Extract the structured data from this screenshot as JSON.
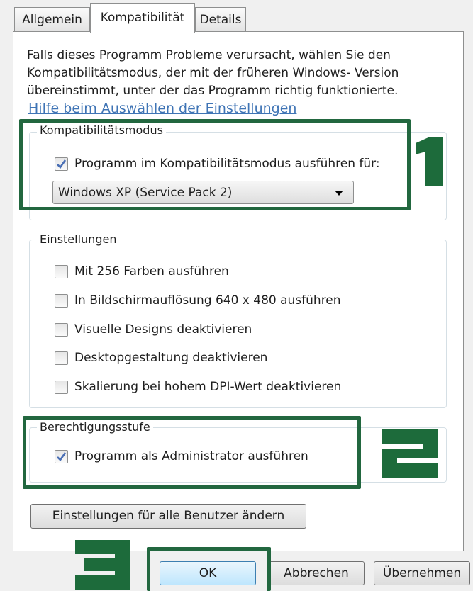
{
  "tabs": [
    {
      "label": "Allgemein"
    },
    {
      "label": "Kompatibilität"
    },
    {
      "label": "Details"
    }
  ],
  "intro_text": "Falls dieses Programm Probleme verursacht, wählen Sie den Kompatibilitätsmodus, der mit der früheren Windows- Version übereinstimmt, unter der das Programm richtig funktionierte.",
  "help_link": "Hilfe beim Auswählen der Einstellungen",
  "compat_mode": {
    "title": "Kompatibilitätsmodus",
    "checkbox_label": "Programm im Kompatibilitätsmodus ausführen für:",
    "checked": true,
    "selected_os": "Windows XP (Service Pack 2)"
  },
  "settings": {
    "title": "Einstellungen",
    "options": [
      {
        "label": "Mit 256 Farben ausführen",
        "checked": false
      },
      {
        "label": "In Bildschirmauflösung 640 x 480 ausführen",
        "checked": false
      },
      {
        "label": "Visuelle Designs deaktivieren",
        "checked": false
      },
      {
        "label": "Desktopgestaltung deaktivieren",
        "checked": false
      },
      {
        "label": "Skalierung bei hohem DPI-Wert deaktivieren",
        "checked": false
      }
    ]
  },
  "privilege": {
    "title": "Berechtigungsstufe",
    "checkbox_label": "Programm als Administrator ausführen",
    "checked": true
  },
  "all_users_button": "Einstellungen für alle Benutzer ändern",
  "buttons": {
    "ok": "OK",
    "cancel": "Abbrechen",
    "apply": "Übernehmen"
  },
  "markers": [
    "1",
    "2",
    "3"
  ],
  "colors": {
    "highlight": "#22673f",
    "link": "#3f74b5",
    "checkmark": "#4a6fb5"
  }
}
